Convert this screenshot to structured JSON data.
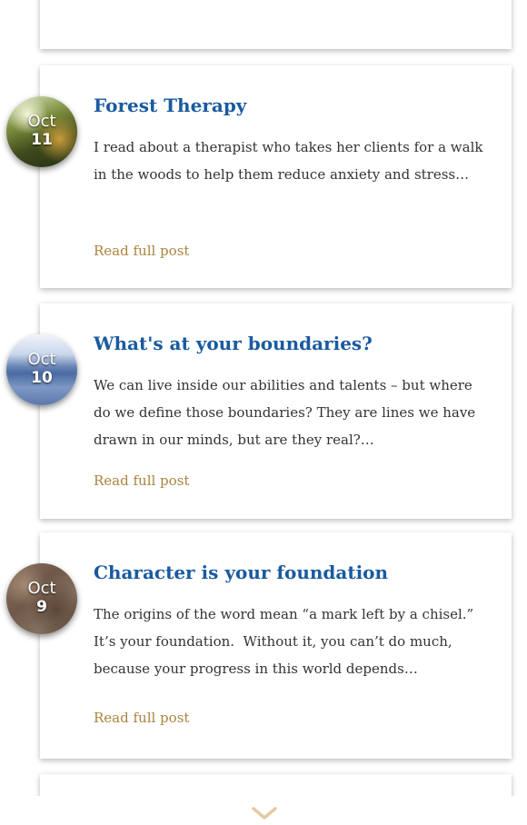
{
  "navigation": {
    "scroll_up_icon": "chevron-up-icon",
    "scroll_down_icon": "chevron-down-icon",
    "arrow_color": "#e4c9a6"
  },
  "colors": {
    "title": "#1a5aa0",
    "link": "#a9843f",
    "text": "#333333"
  },
  "posts": [
    {
      "month": "Oct",
      "day": "11",
      "badge_image": "forest",
      "title": "Forest Therapy",
      "excerpt": "I read about a therapist who takes her clients for a walk in the woods to help them reduce anxiety and stress…",
      "link_label": "Read full post"
    },
    {
      "month": "Oct",
      "day": "10",
      "badge_image": "lake",
      "title": "What's at your boundaries?",
      "excerpt": "We can live inside our abilities and talents – but where do we define those boundaries? They are lines we have drawn in our minds, but are they real?…",
      "link_label": "Read full post"
    },
    {
      "month": "Oct",
      "day": "9",
      "badge_image": "stone",
      "title": "Character is your foundation",
      "excerpt": "The origins of the word mean “a mark left by a chisel.” It’s your foundation.  Without it, you can’t do much, because your progress in this world depends…",
      "link_label": "Read full post"
    }
  ]
}
